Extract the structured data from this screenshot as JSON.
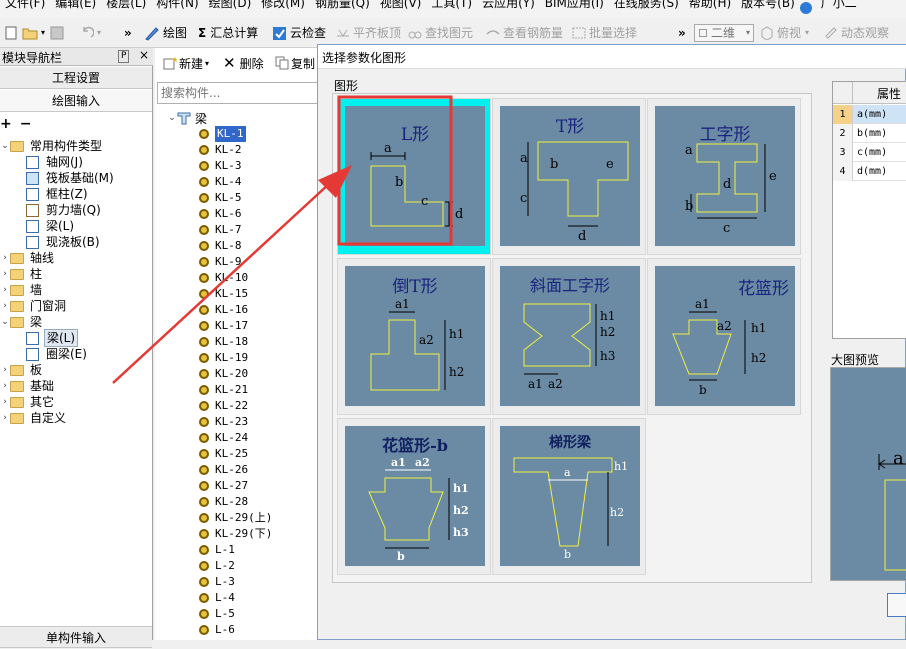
{
  "menu": [
    "文件(F)",
    "编辑(E)",
    "楼层(L)",
    "构件(N)",
    "绘图(D)",
    "修改(M)",
    "钢筋量(Q)",
    "视图(V)",
    "工具(T)",
    "云应用(Y)",
    "BIM应用(I)",
    "在线服务(S)",
    "帮助(H)",
    "版本号(B)",
    "广小二"
  ],
  "toolbar": {
    "more": "»",
    "draw": "绘图",
    "summary": "汇总计算",
    "cloud_check": "云检查",
    "flat_board": "平齐板顶",
    "find_elem": "查找图元",
    "view_rebar": "查看钢筋量",
    "batch_select": "批量选择",
    "view_mode": "二维",
    "top_view": "俯视",
    "dyn_observe": "动态观察"
  },
  "left_panel": {
    "title": "模块导航栏",
    "pin": "P",
    "close": "×",
    "project_settings": "工程设置",
    "drawing_input": "绘图输入",
    "single_input": "单构件输入",
    "tree": [
      {
        "label": "常用构件类型",
        "level": 0,
        "expanded": true,
        "type": "folder"
      },
      {
        "label": "轴网(J)",
        "level": 1,
        "type": "grid"
      },
      {
        "label": "筏板基础(M)",
        "level": 1,
        "type": "raft"
      },
      {
        "label": "框柱(Z)",
        "level": 1,
        "type": "column"
      },
      {
        "label": "剪力墙(Q)",
        "level": 1,
        "type": "wall"
      },
      {
        "label": "梁(L)",
        "level": 1,
        "type": "beam"
      },
      {
        "label": "现浇板(B)",
        "level": 1,
        "type": "slab"
      },
      {
        "label": "轴线",
        "level": 0,
        "type": "folder"
      },
      {
        "label": "柱",
        "level": 0,
        "type": "folder"
      },
      {
        "label": "墙",
        "level": 0,
        "type": "folder"
      },
      {
        "label": "门窗洞",
        "level": 0,
        "type": "folder"
      },
      {
        "label": "梁",
        "level": 0,
        "expanded": true,
        "type": "folder"
      },
      {
        "label": "梁(L)",
        "level": 1,
        "type": "beam",
        "selected": true
      },
      {
        "label": "圈梁(E)",
        "level": 1,
        "type": "slab"
      },
      {
        "label": "板",
        "level": 0,
        "type": "folder"
      },
      {
        "label": "基础",
        "level": 0,
        "type": "folder"
      },
      {
        "label": "其它",
        "level": 0,
        "type": "folder"
      },
      {
        "label": "自定义",
        "level": 0,
        "type": "folder"
      }
    ]
  },
  "component_list": {
    "new": "新建",
    "delete": "删除",
    "copy": "复制",
    "search_placeholder": "搜索构件...",
    "root": "梁",
    "items": [
      "KL-1",
      "KL-2",
      "KL-3",
      "KL-4",
      "KL-5",
      "KL-6",
      "KL-7",
      "KL-8",
      "KL-9",
      "KL-10",
      "KL-15",
      "KL-16",
      "KL-17",
      "KL-18",
      "KL-19",
      "KL-20",
      "KL-21",
      "KL-22",
      "KL-23",
      "KL-24",
      "KL-25",
      "KL-26",
      "KL-27",
      "KL-28",
      "KL-29(上)",
      "KL-29(下)",
      "L-1",
      "L-2",
      "L-3",
      "L-4",
      "L-5",
      "L-6"
    ],
    "selected": "KL-1"
  },
  "dialog": {
    "title": "选择参数化图形",
    "group_label": "图形",
    "shapes": [
      {
        "name": "L形",
        "params": [
          "a",
          "b",
          "c",
          "d"
        ]
      },
      {
        "name": "T形",
        "params": [
          "a",
          "b",
          "c",
          "d",
          "e"
        ]
      },
      {
        "name": "工字形",
        "params": [
          "a",
          "b",
          "c",
          "d",
          "e"
        ]
      },
      {
        "name": "倒T形",
        "params": [
          "a1",
          "a2",
          "h1",
          "h2"
        ]
      },
      {
        "name": "斜面工字形",
        "params": [
          "h1",
          "h2",
          "h3",
          "a1",
          "a2"
        ]
      },
      {
        "name": "花篮形",
        "params": [
          "a1",
          "a2",
          "h1",
          "h2",
          "b"
        ]
      },
      {
        "name": "花篮形-b",
        "params": [
          "a1",
          "a2",
          "h1",
          "h2",
          "h3",
          "b"
        ]
      },
      {
        "name": "梯形梁",
        "params": [
          "h1",
          "a",
          "h2",
          "b"
        ]
      }
    ],
    "selected_shape": "L形",
    "property_header": "属性名",
    "properties": [
      {
        "index": "1",
        "name": "a(mm)"
      },
      {
        "index": "2",
        "name": "b(mm)"
      },
      {
        "index": "3",
        "name": "c(mm)"
      },
      {
        "index": "4",
        "name": "d(mm)"
      }
    ],
    "preview_label": "大图预览",
    "preview_param": "a"
  },
  "colors": {
    "shape_bg": "#6a8ba3",
    "shape_line": "#f0f040",
    "selection_cyan": "#00f0f0",
    "highlight_red": "#e53935",
    "list_selection": "#3167c9"
  }
}
